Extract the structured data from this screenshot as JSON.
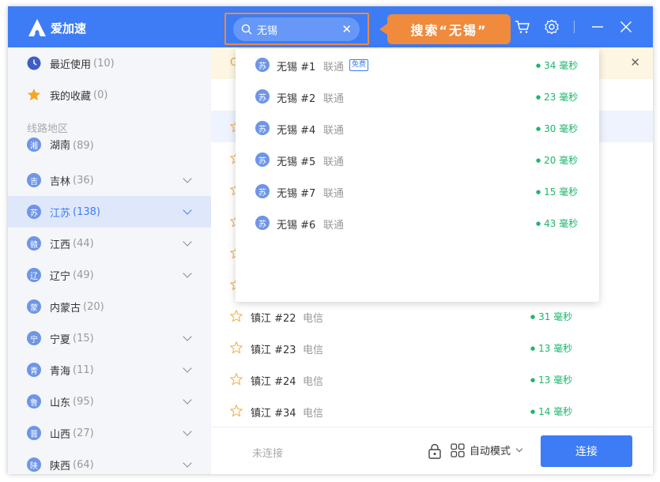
{
  "app": {
    "name": "爱加速"
  },
  "search": {
    "value": "无锡"
  },
  "callout": {
    "text": "搜索“无锡”"
  },
  "sidebar": {
    "recent": {
      "label": "最近使用",
      "count": "(10)"
    },
    "favorites": {
      "label": "我的收藏",
      "count": "(0)"
    },
    "section_label": "线路地区",
    "regions": [
      {
        "badge": "湘",
        "label": "湖南",
        "count": "(89)"
      },
      {
        "badge": "吉",
        "label": "吉林",
        "count": "(36)"
      },
      {
        "badge": "苏",
        "label": "江苏",
        "count": "(138)"
      },
      {
        "badge": "赣",
        "label": "江西",
        "count": "(44)"
      },
      {
        "badge": "辽",
        "label": "辽宁",
        "count": "(49)"
      },
      {
        "badge": "蒙",
        "label": "内蒙古",
        "count": "(20)"
      },
      {
        "badge": "宁",
        "label": "宁夏",
        "count": "(15)"
      },
      {
        "badge": "青",
        "label": "青海",
        "count": "(11)"
      },
      {
        "badge": "鲁",
        "label": "山东",
        "count": "(95)"
      },
      {
        "badge": "晋",
        "label": "山西",
        "count": "(27)"
      },
      {
        "badge": "陕",
        "label": "陕西",
        "count": "(64)"
      }
    ]
  },
  "notice": {
    "text": "C"
  },
  "servers": [
    {
      "name": "镇江 #22",
      "isp": "电信",
      "ping": "31 毫秒"
    },
    {
      "name": "镇江 #23",
      "isp": "电信",
      "ping": "13 毫秒"
    },
    {
      "name": "镇江 #24",
      "isp": "电信",
      "ping": "13 毫秒"
    },
    {
      "name": "镇江 #34",
      "isp": "电信",
      "ping": "14 毫秒"
    }
  ],
  "dropdown": [
    {
      "badge": "苏",
      "name": "无锡 #1",
      "isp": "联通",
      "tag": "免费",
      "ping": "34 毫秒"
    },
    {
      "badge": "苏",
      "name": "无锡 #2",
      "isp": "联通",
      "ping": "23 毫秒"
    },
    {
      "badge": "苏",
      "name": "无锡 #4",
      "isp": "联通",
      "ping": "30 毫秒"
    },
    {
      "badge": "苏",
      "name": "无锡 #5",
      "isp": "联通",
      "ping": "20 毫秒"
    },
    {
      "badge": "苏",
      "name": "无锡 #7",
      "isp": "联通",
      "ping": "15 毫秒"
    },
    {
      "badge": "苏",
      "name": "无锡 #6",
      "isp": "联通",
      "ping": "43 毫秒"
    }
  ],
  "footer": {
    "status": "未连接",
    "mode": "自动模式",
    "connect": "连接"
  },
  "colors": {
    "brand": "#3d7cf5",
    "callout": "#f08a3c",
    "ping": "#1bb66b",
    "star": "#f5b04a"
  },
  "icons": [
    "search-icon",
    "clear-icon",
    "cart-icon",
    "gear-icon",
    "minimize-icon",
    "close-icon",
    "clock-icon",
    "star-icon",
    "lock-icon",
    "grid-icon",
    "chevron-down-icon"
  ]
}
